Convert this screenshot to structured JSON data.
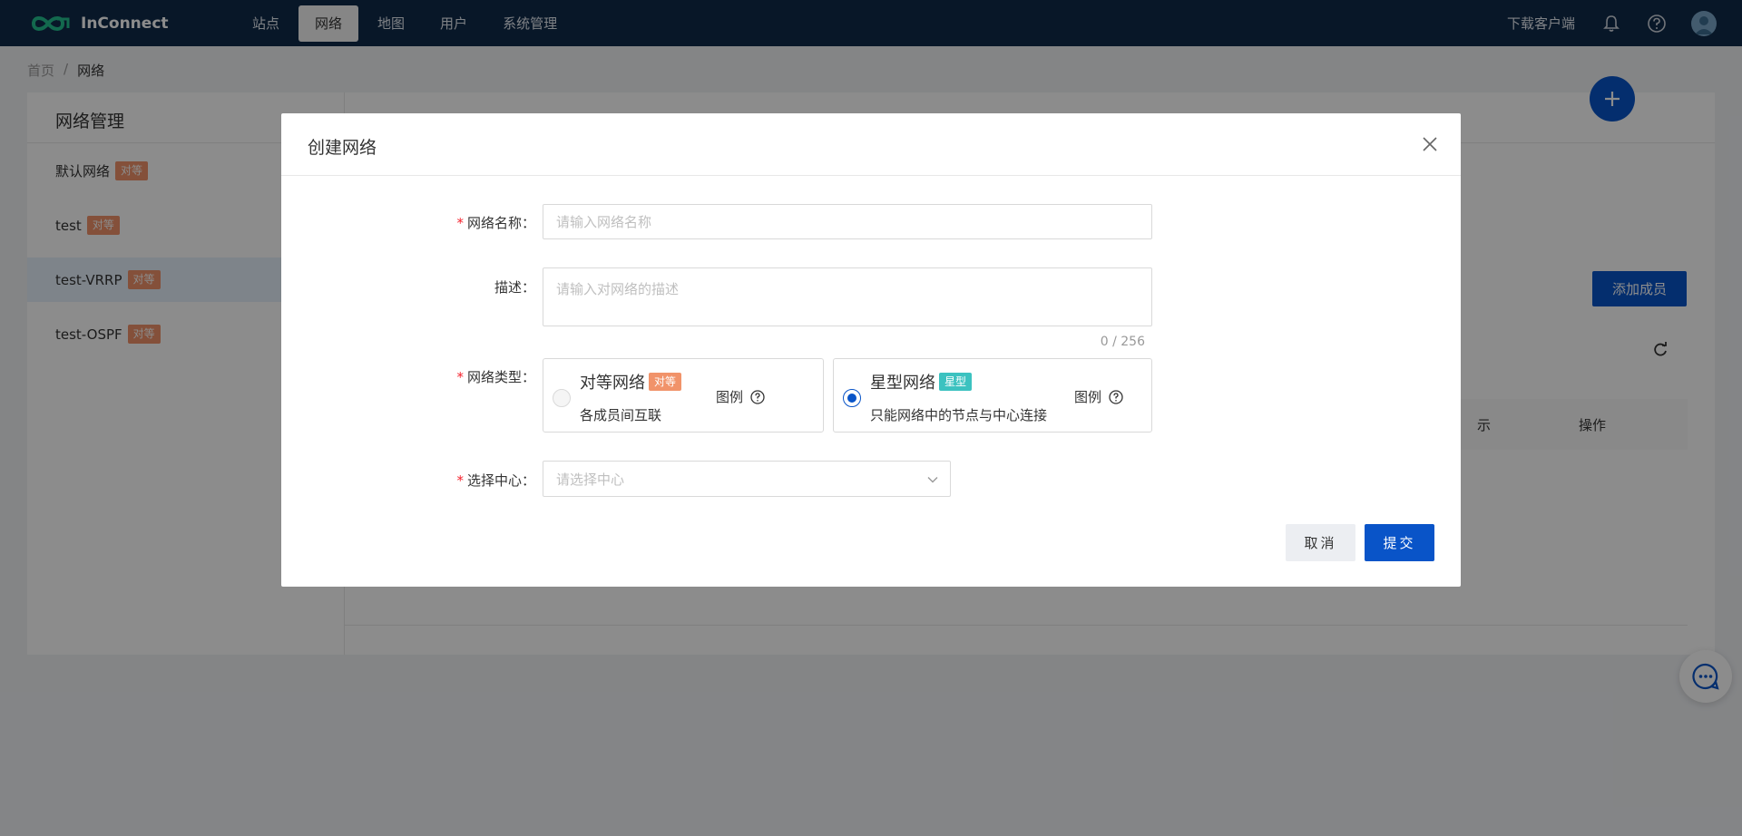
{
  "app": {
    "name": "InConnect"
  },
  "nav": {
    "items": [
      {
        "label": "站点",
        "active": false
      },
      {
        "label": "网络",
        "active": true
      },
      {
        "label": "地图",
        "active": false
      },
      {
        "label": "用户",
        "active": false
      },
      {
        "label": "系统管理",
        "active": false
      }
    ],
    "download_label": "下载客户端",
    "icons": [
      "bell-icon",
      "help-icon",
      "user-avatar"
    ]
  },
  "breadcrumb": {
    "home": "首页",
    "sep": "/",
    "current": "网络"
  },
  "sidebar": {
    "title": "网络管理",
    "networks": [
      {
        "name": "默认网络",
        "tag": "对等",
        "active": false
      },
      {
        "name": "test",
        "tag": "对等",
        "active": false
      },
      {
        "name": "test-VRRP",
        "tag": "对等",
        "active": true
      },
      {
        "name": "test-OSPF",
        "tag": "对等",
        "active": false
      }
    ]
  },
  "content": {
    "add_member_label": "添加成员",
    "table_op_header": "操作",
    "table_partial_header": "示"
  },
  "modal": {
    "title": "创建网络",
    "fields": {
      "name": {
        "label": "网络名称",
        "required": true,
        "placeholder": "请输入网络名称",
        "value": ""
      },
      "desc": {
        "label": "描述",
        "required": false,
        "placeholder": "请输入对网络的描述",
        "value": "",
        "counter": "0 / 256"
      },
      "type": {
        "label": "网络类型",
        "required": true,
        "options": [
          {
            "name": "对等网络",
            "tag": "对等",
            "desc": "各成员间互联",
            "legend": "图例",
            "selected": false
          },
          {
            "name": "星型网络",
            "tag": "星型",
            "desc": "只能网络中的节点与中心连接",
            "legend": "图例",
            "selected": true
          }
        ]
      },
      "center": {
        "label": "选择中心",
        "required": true,
        "placeholder": "请选择中心"
      }
    },
    "cancel_label": "取消",
    "submit_label": "提交"
  },
  "colors": {
    "nav_bg": "#0f2a4a",
    "primary": "#0954c8",
    "tag_peer": "#f1936a",
    "tag_star": "#3cc2c0"
  }
}
